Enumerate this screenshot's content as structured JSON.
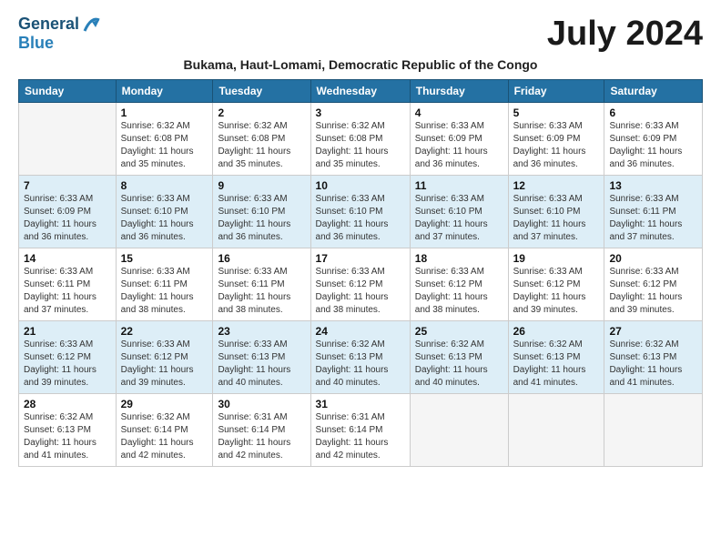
{
  "header": {
    "logo_line1": "General",
    "logo_line2": "Blue",
    "month_year": "July 2024",
    "subtitle": "Bukama, Haut-Lomami, Democratic Republic of the Congo"
  },
  "weekdays": [
    "Sunday",
    "Monday",
    "Tuesday",
    "Wednesday",
    "Thursday",
    "Friday",
    "Saturday"
  ],
  "weeks": [
    [
      {
        "day": "",
        "sunrise": "",
        "sunset": "",
        "daylight": ""
      },
      {
        "day": "1",
        "sunrise": "Sunrise: 6:32 AM",
        "sunset": "Sunset: 6:08 PM",
        "daylight": "Daylight: 11 hours and 35 minutes."
      },
      {
        "day": "2",
        "sunrise": "Sunrise: 6:32 AM",
        "sunset": "Sunset: 6:08 PM",
        "daylight": "Daylight: 11 hours and 35 minutes."
      },
      {
        "day": "3",
        "sunrise": "Sunrise: 6:32 AM",
        "sunset": "Sunset: 6:08 PM",
        "daylight": "Daylight: 11 hours and 35 minutes."
      },
      {
        "day": "4",
        "sunrise": "Sunrise: 6:33 AM",
        "sunset": "Sunset: 6:09 PM",
        "daylight": "Daylight: 11 hours and 36 minutes."
      },
      {
        "day": "5",
        "sunrise": "Sunrise: 6:33 AM",
        "sunset": "Sunset: 6:09 PM",
        "daylight": "Daylight: 11 hours and 36 minutes."
      },
      {
        "day": "6",
        "sunrise": "Sunrise: 6:33 AM",
        "sunset": "Sunset: 6:09 PM",
        "daylight": "Daylight: 11 hours and 36 minutes."
      }
    ],
    [
      {
        "day": "7",
        "sunrise": "Sunrise: 6:33 AM",
        "sunset": "Sunset: 6:09 PM",
        "daylight": "Daylight: 11 hours and 36 minutes."
      },
      {
        "day": "8",
        "sunrise": "Sunrise: 6:33 AM",
        "sunset": "Sunset: 6:10 PM",
        "daylight": "Daylight: 11 hours and 36 minutes."
      },
      {
        "day": "9",
        "sunrise": "Sunrise: 6:33 AM",
        "sunset": "Sunset: 6:10 PM",
        "daylight": "Daylight: 11 hours and 36 minutes."
      },
      {
        "day": "10",
        "sunrise": "Sunrise: 6:33 AM",
        "sunset": "Sunset: 6:10 PM",
        "daylight": "Daylight: 11 hours and 36 minutes."
      },
      {
        "day": "11",
        "sunrise": "Sunrise: 6:33 AM",
        "sunset": "Sunset: 6:10 PM",
        "daylight": "Daylight: 11 hours and 37 minutes."
      },
      {
        "day": "12",
        "sunrise": "Sunrise: 6:33 AM",
        "sunset": "Sunset: 6:10 PM",
        "daylight": "Daylight: 11 hours and 37 minutes."
      },
      {
        "day": "13",
        "sunrise": "Sunrise: 6:33 AM",
        "sunset": "Sunset: 6:11 PM",
        "daylight": "Daylight: 11 hours and 37 minutes."
      }
    ],
    [
      {
        "day": "14",
        "sunrise": "Sunrise: 6:33 AM",
        "sunset": "Sunset: 6:11 PM",
        "daylight": "Daylight: 11 hours and 37 minutes."
      },
      {
        "day": "15",
        "sunrise": "Sunrise: 6:33 AM",
        "sunset": "Sunset: 6:11 PM",
        "daylight": "Daylight: 11 hours and 38 minutes."
      },
      {
        "day": "16",
        "sunrise": "Sunrise: 6:33 AM",
        "sunset": "Sunset: 6:11 PM",
        "daylight": "Daylight: 11 hours and 38 minutes."
      },
      {
        "day": "17",
        "sunrise": "Sunrise: 6:33 AM",
        "sunset": "Sunset: 6:12 PM",
        "daylight": "Daylight: 11 hours and 38 minutes."
      },
      {
        "day": "18",
        "sunrise": "Sunrise: 6:33 AM",
        "sunset": "Sunset: 6:12 PM",
        "daylight": "Daylight: 11 hours and 38 minutes."
      },
      {
        "day": "19",
        "sunrise": "Sunrise: 6:33 AM",
        "sunset": "Sunset: 6:12 PM",
        "daylight": "Daylight: 11 hours and 39 minutes."
      },
      {
        "day": "20",
        "sunrise": "Sunrise: 6:33 AM",
        "sunset": "Sunset: 6:12 PM",
        "daylight": "Daylight: 11 hours and 39 minutes."
      }
    ],
    [
      {
        "day": "21",
        "sunrise": "Sunrise: 6:33 AM",
        "sunset": "Sunset: 6:12 PM",
        "daylight": "Daylight: 11 hours and 39 minutes."
      },
      {
        "day": "22",
        "sunrise": "Sunrise: 6:33 AM",
        "sunset": "Sunset: 6:12 PM",
        "daylight": "Daylight: 11 hours and 39 minutes."
      },
      {
        "day": "23",
        "sunrise": "Sunrise: 6:33 AM",
        "sunset": "Sunset: 6:13 PM",
        "daylight": "Daylight: 11 hours and 40 minutes."
      },
      {
        "day": "24",
        "sunrise": "Sunrise: 6:32 AM",
        "sunset": "Sunset: 6:13 PM",
        "daylight": "Daylight: 11 hours and 40 minutes."
      },
      {
        "day": "25",
        "sunrise": "Sunrise: 6:32 AM",
        "sunset": "Sunset: 6:13 PM",
        "daylight": "Daylight: 11 hours and 40 minutes."
      },
      {
        "day": "26",
        "sunrise": "Sunrise: 6:32 AM",
        "sunset": "Sunset: 6:13 PM",
        "daylight": "Daylight: 11 hours and 41 minutes."
      },
      {
        "day": "27",
        "sunrise": "Sunrise: 6:32 AM",
        "sunset": "Sunset: 6:13 PM",
        "daylight": "Daylight: 11 hours and 41 minutes."
      }
    ],
    [
      {
        "day": "28",
        "sunrise": "Sunrise: 6:32 AM",
        "sunset": "Sunset: 6:13 PM",
        "daylight": "Daylight: 11 hours and 41 minutes."
      },
      {
        "day": "29",
        "sunrise": "Sunrise: 6:32 AM",
        "sunset": "Sunset: 6:14 PM",
        "daylight": "Daylight: 11 hours and 42 minutes."
      },
      {
        "day": "30",
        "sunrise": "Sunrise: 6:31 AM",
        "sunset": "Sunset: 6:14 PM",
        "daylight": "Daylight: 11 hours and 42 minutes."
      },
      {
        "day": "31",
        "sunrise": "Sunrise: 6:31 AM",
        "sunset": "Sunset: 6:14 PM",
        "daylight": "Daylight: 11 hours and 42 minutes."
      },
      {
        "day": "",
        "sunrise": "",
        "sunset": "",
        "daylight": ""
      },
      {
        "day": "",
        "sunrise": "",
        "sunset": "",
        "daylight": ""
      },
      {
        "day": "",
        "sunrise": "",
        "sunset": "",
        "daylight": ""
      }
    ]
  ]
}
